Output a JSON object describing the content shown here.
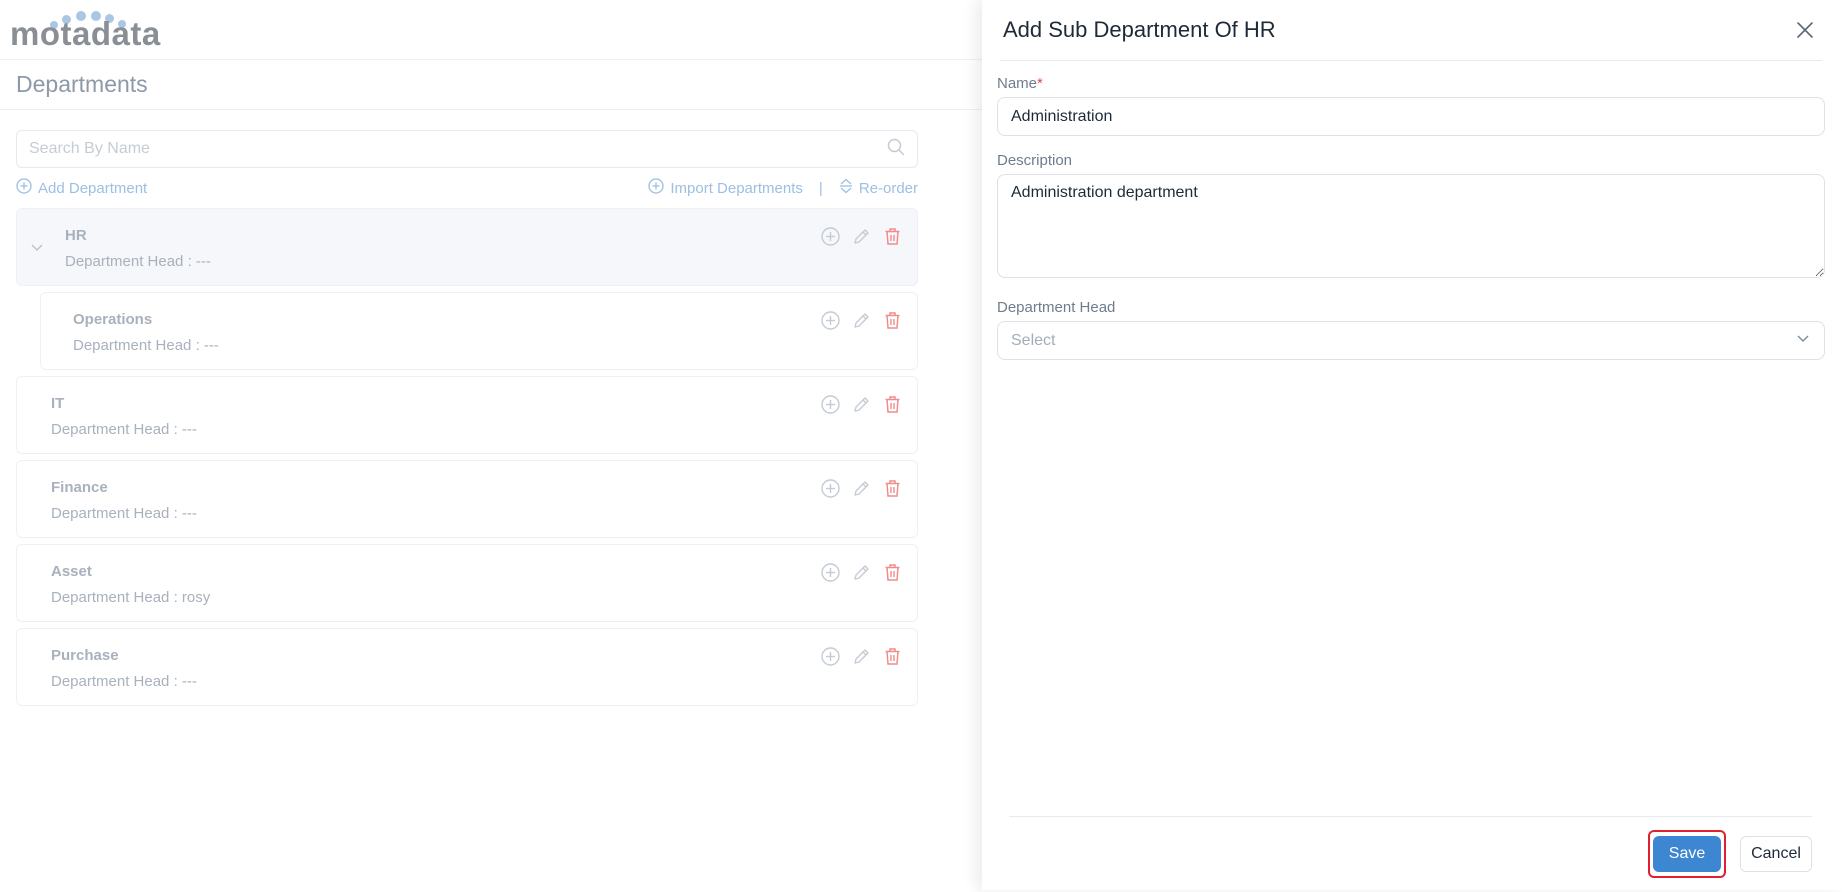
{
  "brand": {
    "logo_text": "motadata"
  },
  "page": {
    "title": "Departments"
  },
  "search": {
    "placeholder": "Search By Name"
  },
  "actions": {
    "add_department": "Add Department",
    "import_departments": "Import Departments",
    "separator": "|",
    "reorder": "Re-order"
  },
  "departments": [
    {
      "name": "HR",
      "head": "Department Head : ---",
      "expanded": true,
      "level": 0
    },
    {
      "name": "Operations",
      "head": "Department Head : ---",
      "expanded": false,
      "level": 1
    },
    {
      "name": "IT",
      "head": "Department Head : ---",
      "expanded": false,
      "level": 0
    },
    {
      "name": "Finance",
      "head": "Department Head : ---",
      "expanded": false,
      "level": 0
    },
    {
      "name": "Asset",
      "head": "Department Head : rosy",
      "expanded": false,
      "level": 0
    },
    {
      "name": "Purchase",
      "head": "Department Head : ---",
      "expanded": false,
      "level": 0
    }
  ],
  "drawer": {
    "title": "Add Sub Department Of HR",
    "name_label": "Name",
    "required_mark": "*",
    "name_value": "Administration",
    "description_label": "Description",
    "description_value": "Administration department",
    "head_label": "Department Head",
    "head_placeholder": "Select",
    "save_label": "Save",
    "cancel_label": "Cancel"
  },
  "colors": {
    "accent": "#3d86d1",
    "delete": "#f08c8c",
    "highlight": "#e0202e"
  },
  "icons": [
    "search-icon",
    "plus-circle-icon",
    "reorder-icon",
    "chevron-down-icon",
    "edit-icon",
    "trash-icon",
    "close-icon"
  ]
}
